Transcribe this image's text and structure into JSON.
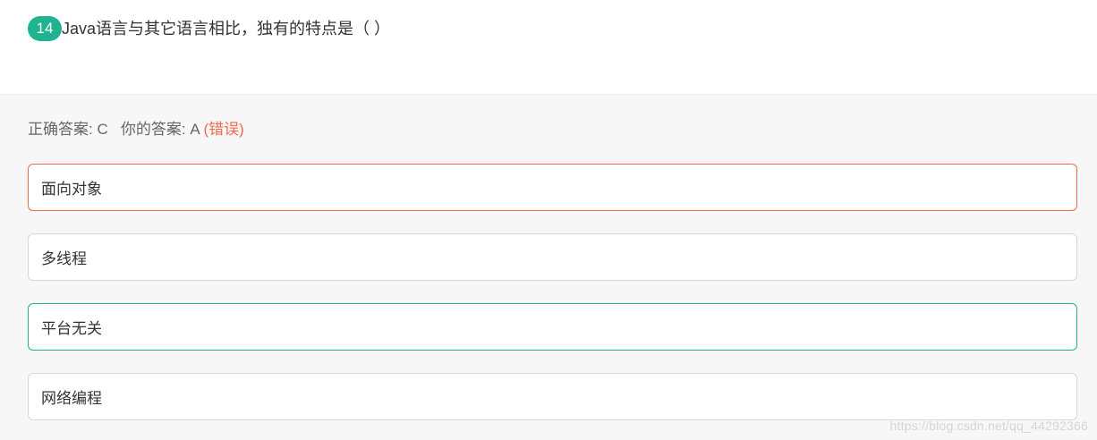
{
  "question": {
    "number": "14",
    "text": "Java语言与其它语言相比，独有的特点是（ ）"
  },
  "answer": {
    "correct_label": "正确答案: C",
    "yours_label": "你的答案: A",
    "result_label": "(错误)"
  },
  "options": [
    {
      "text": "面向对象",
      "state": "chosen-wrong"
    },
    {
      "text": "多线程",
      "state": "normal"
    },
    {
      "text": "平台无关",
      "state": "correct"
    },
    {
      "text": "网络编程",
      "state": "normal"
    }
  ],
  "watermark": "https://blog.csdn.net/qq_44292366",
  "colors": {
    "accent_green": "#1fb38f",
    "error_red": "#ed6a4d",
    "panel_bg": "#f7f7f7"
  }
}
